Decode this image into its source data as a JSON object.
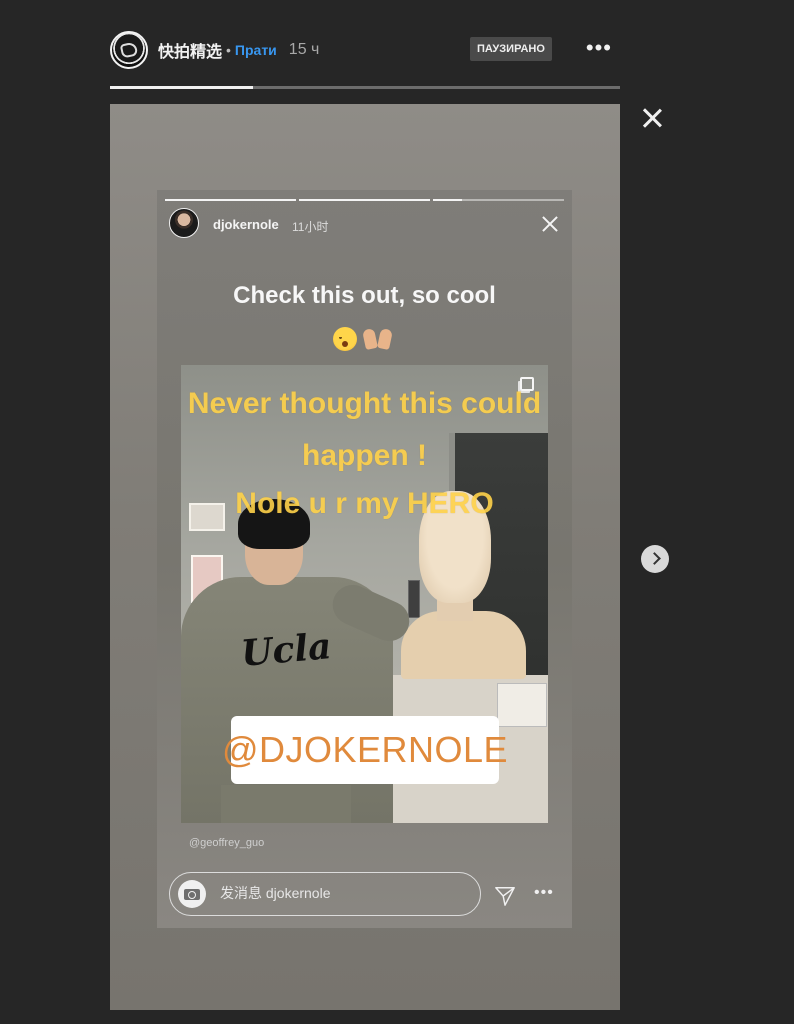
{
  "header": {
    "username": "快拍精选",
    "separator": "•",
    "follow_label": "Прати",
    "time": "15 ч",
    "paused_badge": "ПАУЗИРАНО",
    "more_glyph": "•••"
  },
  "progress": {
    "fraction": 0.28
  },
  "icons": {
    "close": "close-icon",
    "next": "chevron-right-icon",
    "camera": "camera-icon",
    "send": "send-icon",
    "multi": "multiple-photos-icon"
  },
  "inner_story": {
    "username": "djokernole",
    "time": "11小时",
    "progress_segments": [
      "done",
      "done",
      "part"
    ],
    "caption": "Check this out, so cool",
    "caption_emojis": [
      "astonished-face",
      "raised-hands"
    ],
    "overlay_lines": [
      "Never thought this could",
      "happen !",
      "Nole u r my HERO"
    ],
    "hoodie_text": "Ucla",
    "mention_sticker": "@DJOKERNOLE",
    "photo_credit": "@geoffrey_guo",
    "message_placeholder": "发消息 djokernole",
    "more_glyph": "•••"
  },
  "colors": {
    "background": "#262626",
    "follow": "#3897f0",
    "overlay_text": "#ffd24a",
    "mention_text": "#e08a3c"
  }
}
